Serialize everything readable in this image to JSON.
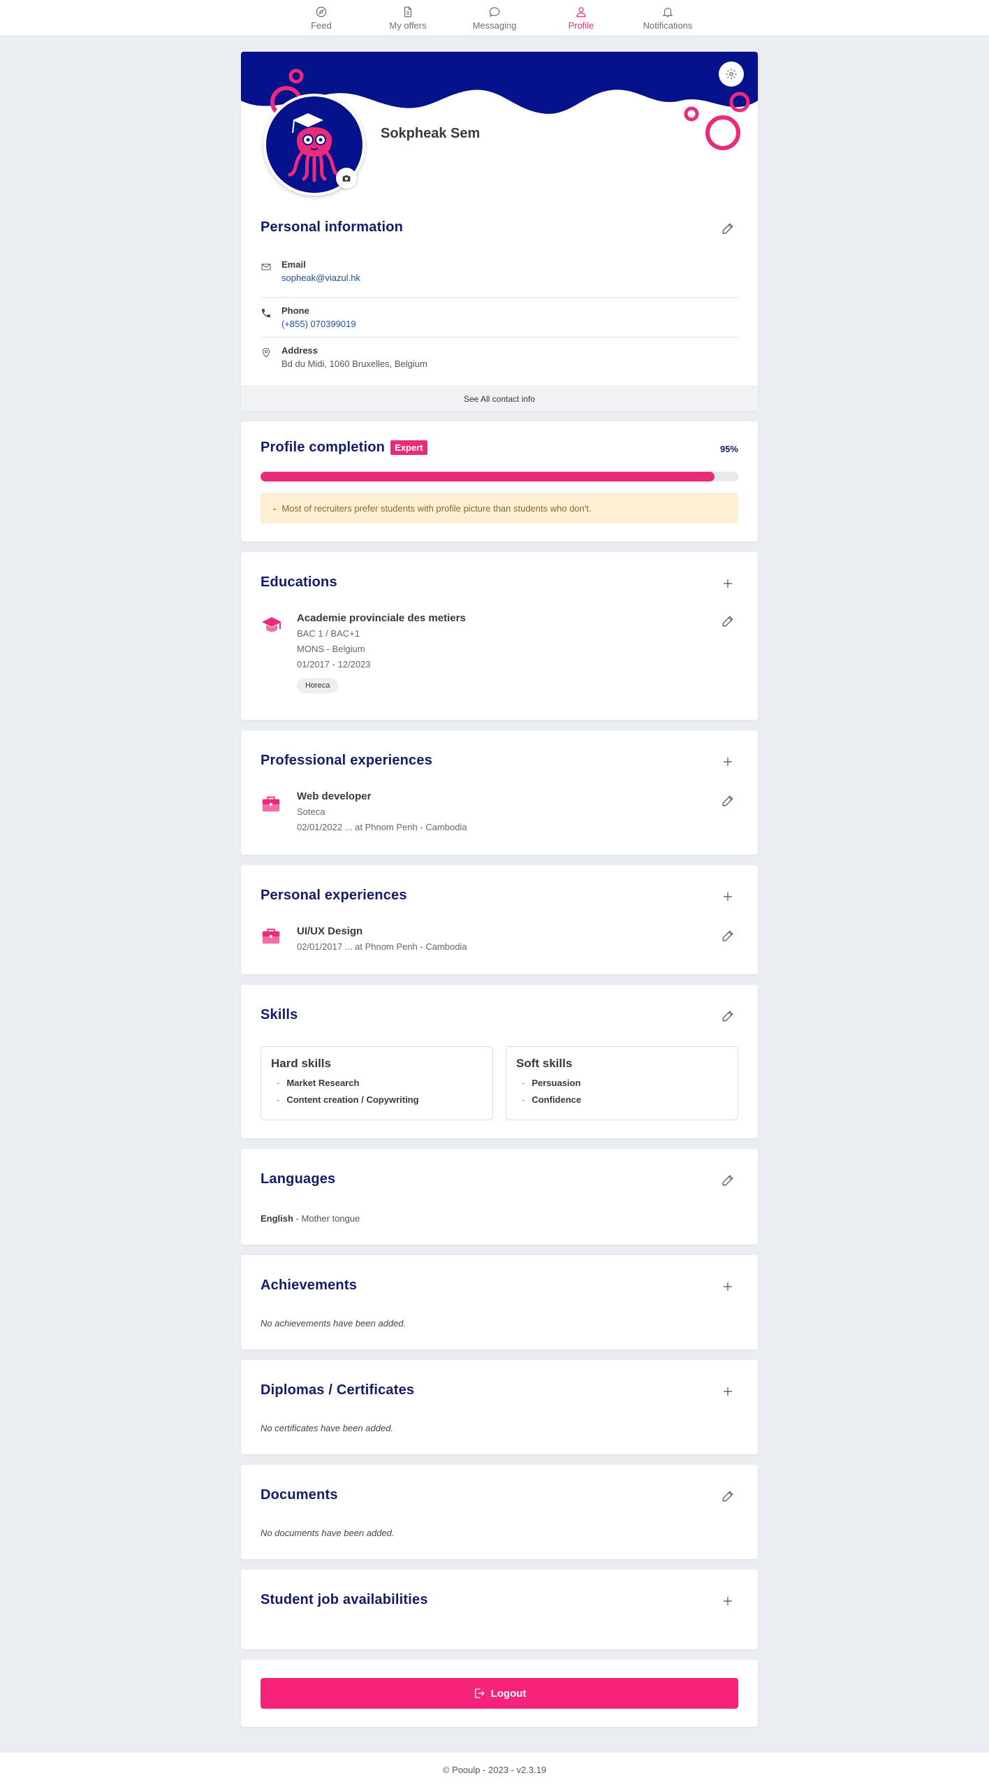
{
  "nav": {
    "items": [
      {
        "label": "Feed",
        "icon": "compass-icon"
      },
      {
        "label": "My offers",
        "icon": "document-icon"
      },
      {
        "label": "Messaging",
        "icon": "chat-icon"
      },
      {
        "label": "Profile",
        "icon": "user-icon",
        "active": true
      },
      {
        "label": "Notifications",
        "icon": "bell-icon"
      }
    ]
  },
  "profile": {
    "name": "Sokpheak Sem",
    "banner_color": "#05128c",
    "accent_color": "#ea2a7b"
  },
  "personal_info": {
    "title": "Personal information",
    "email_label": "Email",
    "email": "sopheak@viazul.hk",
    "phone_label": "Phone",
    "phone": "(+855) 070399019",
    "address_label": "Address",
    "address": "Bd du Midi, 1060 Bruxelles, Belgium",
    "see_all": "See All contact info"
  },
  "completion": {
    "title": "Profile completion",
    "badge": "Expert",
    "percent_label": "95%",
    "percent": 95,
    "tip": "Most of recruiters prefer students with profile picture than students who don't."
  },
  "educations": {
    "title": "Educations",
    "items": [
      {
        "school": "Academie provinciale des metiers",
        "level": "BAC 1 / BAC+1",
        "location": "MONS - Belgium",
        "dates": "01/2017 - 12/2023",
        "tag": "Horeca"
      }
    ]
  },
  "professional": {
    "title": "Professional experiences",
    "items": [
      {
        "role": "Web developer",
        "company": "Soteca",
        "dates": "02/01/2022 ... at Phnom Penh - Cambodia"
      }
    ]
  },
  "personal_exp": {
    "title": "Personal experiences",
    "items": [
      {
        "role": "UI/UX Design",
        "dates": "02/01/2017 ... at Phnom Penh - Cambodia"
      }
    ]
  },
  "skills": {
    "title": "Skills",
    "hard_title": "Hard skills",
    "hard": [
      "Market Research",
      "Content creation / Copywriting"
    ],
    "soft_title": "Soft skills",
    "soft": [
      "Persuasion",
      "Confidence"
    ]
  },
  "languages": {
    "title": "Languages",
    "items": [
      {
        "name": "English",
        "level": "Mother tongue"
      }
    ]
  },
  "achievements": {
    "title": "Achievements",
    "empty": "No achievements have been added."
  },
  "diplomas": {
    "title": "Diplomas / Certificates",
    "empty": "No certificates have been added."
  },
  "documents": {
    "title": "Documents",
    "empty": "No documents have been added."
  },
  "availabilities": {
    "title": "Student job availabilities"
  },
  "logout": {
    "label": "Logout"
  },
  "footer": {
    "text": "© Pooulp - 2023 - v2.3.19"
  }
}
